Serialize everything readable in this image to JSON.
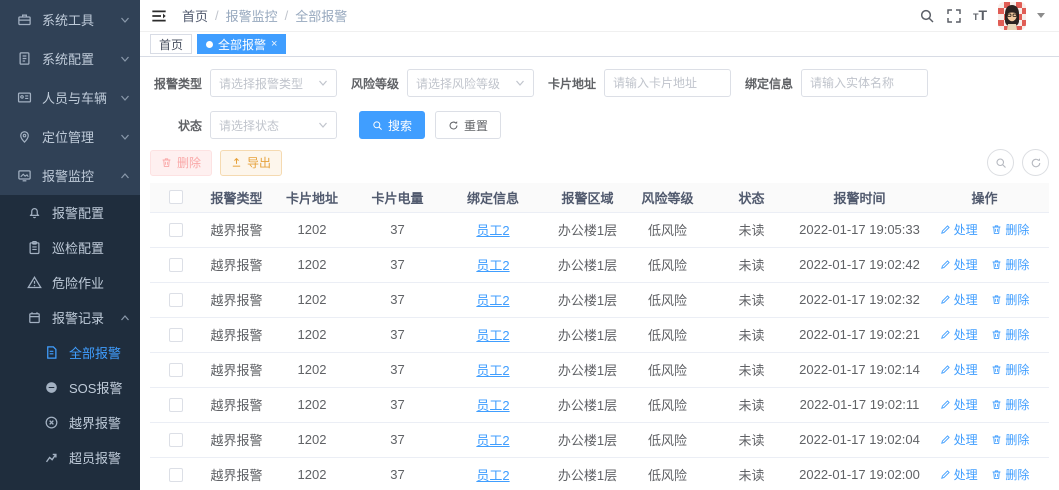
{
  "colors": {
    "accent": "#409EFF",
    "sidebar_bg": "#304156",
    "submenu_bg": "#1f2d3d",
    "danger": "#f56c6c",
    "warning": "#e6a23c",
    "link": "#409EFF"
  },
  "sidebar": {
    "items": [
      {
        "label": "系统工具",
        "icon": "toolbox-icon"
      },
      {
        "label": "系统配置",
        "icon": "config-doc-icon"
      },
      {
        "label": "人员与车辆",
        "icon": "id-card-icon"
      },
      {
        "label": "定位管理",
        "icon": "location-pin-icon"
      },
      {
        "label": "报警监控",
        "icon": "monitor-icon",
        "expanded": true
      }
    ],
    "alarm_children": [
      {
        "label": "报警配置",
        "icon": "bell-config-icon"
      },
      {
        "label": "巡检配置",
        "icon": "clipboard-icon"
      },
      {
        "label": "危险作业",
        "icon": "warning-triangle-icon"
      },
      {
        "label": "报警记录",
        "icon": "record-icon",
        "expanded": true
      }
    ],
    "record_children": [
      {
        "label": "全部报警",
        "icon": "document-icon",
        "active": true
      },
      {
        "label": "SOS报警",
        "icon": "sos-circle-icon"
      },
      {
        "label": "越界报警",
        "icon": "cross-circle-icon"
      },
      {
        "label": "超员报警",
        "icon": "trend-line-icon"
      }
    ]
  },
  "navbar": {
    "breadcrumb": [
      "首页",
      "报警监控",
      "全部报警"
    ],
    "separator": "/",
    "right_icons": [
      "search-icon",
      "fullscreen-icon",
      "font-size-icon",
      "avatar",
      "caret-down-icon"
    ],
    "font_size_glyph": "T"
  },
  "tabs": [
    {
      "label": "首页",
      "active": false
    },
    {
      "label": "全部报警",
      "active": true,
      "closable": true,
      "close_glyph": "×"
    }
  ],
  "filters": {
    "alarm_type": {
      "label": "报警类型",
      "placeholder": "请选择报警类型"
    },
    "risk_level": {
      "label": "风险等级",
      "placeholder": "请选择风险等级"
    },
    "card_address": {
      "label": "卡片地址",
      "placeholder": "请输入卡片地址"
    },
    "binding_info": {
      "label": "绑定信息",
      "placeholder": "请输入实体名称"
    },
    "status": {
      "label": "状态",
      "placeholder": "请选择状态"
    },
    "search_label": "搜索",
    "reset_label": "重置"
  },
  "toolbar": {
    "delete_label": "删除",
    "export_label": "导出"
  },
  "table": {
    "columns": [
      "报警类型",
      "卡片地址",
      "卡片电量",
      "绑定信息",
      "报警区域",
      "风险等级",
      "状态",
      "报警时间",
      "操作"
    ],
    "action_handle": "处理",
    "action_delete": "删除",
    "rows": [
      {
        "type": "越界报警",
        "card": "1202",
        "battery": "37",
        "binding": "员工2",
        "area": "办公楼1层",
        "risk": "低风险",
        "status": "未读",
        "time": "2022-01-17 19:05:33"
      },
      {
        "type": "越界报警",
        "card": "1202",
        "battery": "37",
        "binding": "员工2",
        "area": "办公楼1层",
        "risk": "低风险",
        "status": "未读",
        "time": "2022-01-17 19:02:42"
      },
      {
        "type": "越界报警",
        "card": "1202",
        "battery": "37",
        "binding": "员工2",
        "area": "办公楼1层",
        "risk": "低风险",
        "status": "未读",
        "time": "2022-01-17 19:02:32"
      },
      {
        "type": "越界报警",
        "card": "1202",
        "battery": "37",
        "binding": "员工2",
        "area": "办公楼1层",
        "risk": "低风险",
        "status": "未读",
        "time": "2022-01-17 19:02:21"
      },
      {
        "type": "越界报警",
        "card": "1202",
        "battery": "37",
        "binding": "员工2",
        "area": "办公楼1层",
        "risk": "低风险",
        "status": "未读",
        "time": "2022-01-17 19:02:14"
      },
      {
        "type": "越界报警",
        "card": "1202",
        "battery": "37",
        "binding": "员工2",
        "area": "办公楼1层",
        "risk": "低风险",
        "status": "未读",
        "time": "2022-01-17 19:02:11"
      },
      {
        "type": "越界报警",
        "card": "1202",
        "battery": "37",
        "binding": "员工2",
        "area": "办公楼1层",
        "risk": "低风险",
        "status": "未读",
        "time": "2022-01-17 19:02:04"
      },
      {
        "type": "越界报警",
        "card": "1202",
        "battery": "37",
        "binding": "员工2",
        "area": "办公楼1层",
        "risk": "低风险",
        "status": "未读",
        "time": "2022-01-17 19:02:00"
      }
    ]
  }
}
